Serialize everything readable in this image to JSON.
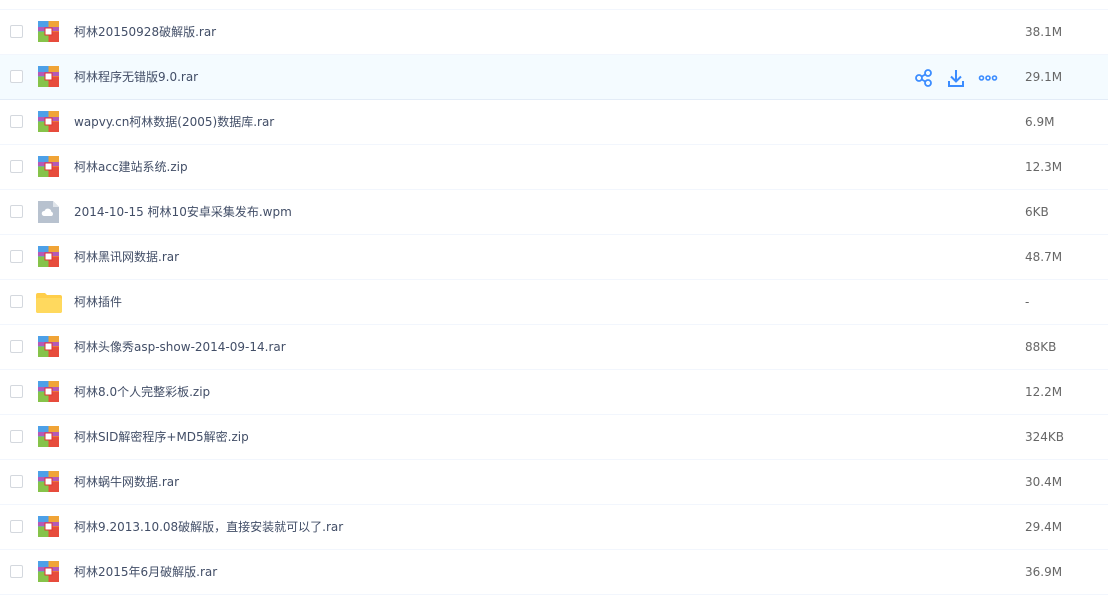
{
  "files": [
    {
      "name": "柯林20150928破解版.rar",
      "size": "38.1M",
      "icon": "archive-icon"
    },
    {
      "name": "柯林程序无错版9.0.rar",
      "size": "29.1M",
      "icon": "archive-icon"
    },
    {
      "name": "wapvy.cn柯林数据(2005)数据库.rar",
      "size": "6.9M",
      "icon": "archive-icon"
    },
    {
      "name": "柯林acc建站系统.zip",
      "size": "12.3M",
      "icon": "archive-icon"
    },
    {
      "name": "2014-10-15 柯林10安卓采集发布.wpm",
      "size": "6KB",
      "icon": "cloud-file-icon"
    },
    {
      "name": "柯林黑讯网数据.rar",
      "size": "48.7M",
      "icon": "archive-icon"
    },
    {
      "name": "柯林插件",
      "size": "-",
      "icon": "folder-icon"
    },
    {
      "name": "柯林头像秀asp-show-2014-09-14.rar",
      "size": "88KB",
      "icon": "archive-icon"
    },
    {
      "name": "柯林8.0个人完整彩板.zip",
      "size": "12.2M",
      "icon": "archive-icon"
    },
    {
      "name": "柯林SID解密程序+MD5解密.zip",
      "size": "324KB",
      "icon": "archive-icon"
    },
    {
      "name": "柯林蜗牛网数据.rar",
      "size": "30.4M",
      "icon": "archive-icon"
    },
    {
      "name": "柯林9.2013.10.08破解版，直接安装就可以了.rar",
      "size": "29.4M",
      "icon": "archive-icon"
    },
    {
      "name": "柯林2015年6月破解版.rar",
      "size": "36.9M",
      "icon": "archive-icon"
    }
  ],
  "hovered_row_actions": [
    "share-icon",
    "download-icon",
    "more-icon"
  ],
  "colors": {
    "accent": "#3b8cff",
    "hover_bg": "#f4fbff",
    "text": "#424e67",
    "size_text": "#666666"
  }
}
